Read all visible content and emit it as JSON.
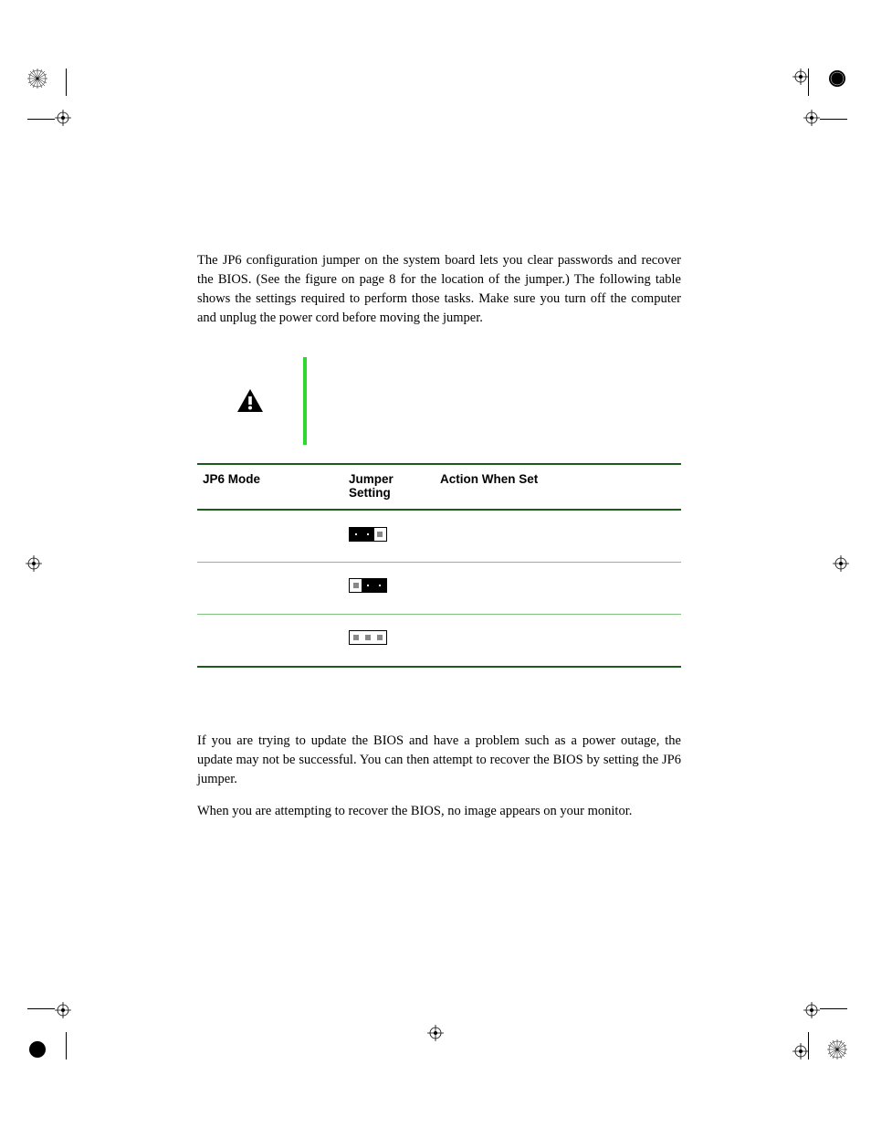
{
  "paragraphs": {
    "intro": "The JP6 configuration jumper on the system board lets you clear passwords and recover the BIOS. (See the figure on page 8 for the location of the jumper.) The following table shows the settings required to perform those tasks. Make sure you turn off the computer and unplug the power cord before moving the jumper.",
    "recover1": "If you are trying to update the BIOS and have a problem such as a power outage, the update may not be successful. You can then attempt to recover the BIOS by setting the JP6 jumper.",
    "recover2": "When you are attempting to recover the BIOS, no image appears on your monitor."
  },
  "table": {
    "headers": {
      "mode": "JP6 Mode",
      "setting": "Jumper Setting",
      "action": "Action When Set"
    },
    "rows": [
      {
        "mode": "",
        "action": ""
      },
      {
        "mode": "",
        "action": ""
      },
      {
        "mode": "",
        "action": ""
      }
    ]
  }
}
